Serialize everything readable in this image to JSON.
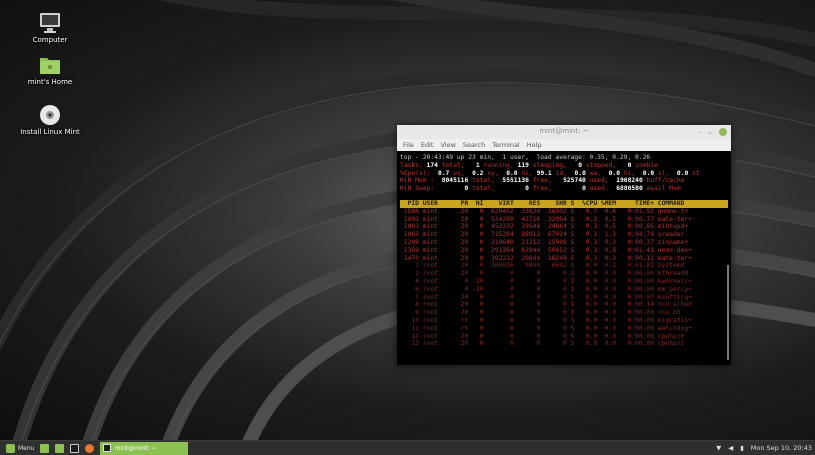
{
  "desktop": {
    "icons": [
      {
        "label": "Computer",
        "icon": "computer-icon"
      },
      {
        "label": "mint's Home",
        "icon": "home-folder-icon"
      },
      {
        "label": "Install Linux Mint",
        "icon": "disc-icon"
      }
    ]
  },
  "terminal": {
    "title": "mint@mint: ~",
    "controls": {
      "minimize": "–",
      "maximize": "⌄"
    },
    "menu": [
      "File",
      "Edit",
      "View",
      "Search",
      "Terminal",
      "Help"
    ],
    "top": {
      "line1": "top - 20:43:49 up 23 min,  1 user,  load average: 0.35, 0.29, 0.26",
      "line2": {
        "a": "Tasks:",
        "b": "174",
        "c": "total,",
        "d": "1",
        "e": "running,",
        "f": "119",
        "g": "sleeping,",
        "h": "0",
        "i": "stopped,",
        "j": "0",
        "k": "zombie"
      },
      "line3": {
        "a": "%Cpu(s):",
        "b": "0.7",
        "c": "us,",
        "d": "0.2",
        "e": "sy,",
        "f": "0.0",
        "g": "ni,",
        "h": "99.1",
        "i": "id,",
        "j": "0.0",
        "k": "wa,",
        "l": "0.0",
        "m": "hi,",
        "n": "0.0",
        "o": "si,",
        "p": "0.0",
        "q": "st"
      },
      "line4": {
        "a": "KiB Mem :",
        "b": "8045116",
        "c": "total,",
        "d": "5551136",
        "e": "free,",
        "f": "525740",
        "g": "used,",
        "h": "1968240",
        "i": "buff/cache"
      },
      "line5": {
        "a": "KiB Swap:",
        "b": "0",
        "c": "total,",
        "d": "0",
        "e": "free,",
        "f": "0",
        "g": "used.",
        "h": "6880500",
        "i": "avail Mem"
      },
      "header": "  PID USER      PR  NI    VIRT    RES    SHR S  %CPU %MEM     TIME+ COMMAND  ",
      "rows": [
        " 1588 mint      20   0  629452  33024  26932 S   0.7  0.4   0:01.92 gnome-t+",
        " 1093 mint      20   0  534280  42716  32984 S   0.3  0.5   0:00.77 mate-ter+",
        " 1003 mint      20   0  452332  39548  24864 S   0.3  0.5   0:00.86 mintupd+",
        " 1066 mint      20   0  715284  88912  67024 S   0.3  1.1   0:04.79 xreader  ",
        " 1208 mint      20   0  219640  21212  15908 S   0.3  0.3   0:00.37 cinnamo+",
        " 1369 mint      20   0  291364  62944  50452 S   0.3  0.8   0:01.41 nemo-des+",
        " 1470 mint      20   0  392212  20844  16248 S   0.3  0.3   0:00.12 mate-ter+",
        "    1 root      20   0  160016   9808   6692 S   0.0  0.1   0:01.81 systemd  ",
        "    2 root      20   0       0      0      0 S   0.0  0.0   0:00.00 kthreadd ",
        "    4 root       0 -20       0      0      0 I   0.0  0.0   0:00.00 kworker/+",
        "    6 root       0 -20       0      0      0 I   0.0  0.0   0:00.00 mm_percp+",
        "    7 root      20   0       0      0      0 S   0.0  0.0   0:00.07 ksoftirq+",
        "    8 root      20   0       0      0      0 I   0.0  0.0   0:00.14 rcu_sched",
        "    9 root      20   0       0      0      0 I   0.0  0.0   0:00.00 rcu_bh   ",
        "   10 root      rt   0       0      0      0 S   0.0  0.0   0:00.00 migratio+",
        "   11 root      rt   0       0      0      0 S   0.0  0.0   0:00.00 watchdog+",
        "   12 root      20   0       0      0      0 S   0.0  0.0   0:00.00 cpuhp/0  ",
        "   13 root      20   0       0      0      0 S   0.0  0.0   0:00.00 cpuhp/1  "
      ]
    }
  },
  "taskbar": {
    "menu_label": "Menu",
    "task_label": "mint@mint: ~",
    "clock": "Mon Sep 10, 20:43",
    "colors": {
      "accent": "#8cc152",
      "bar": "#2f2f2f"
    }
  }
}
